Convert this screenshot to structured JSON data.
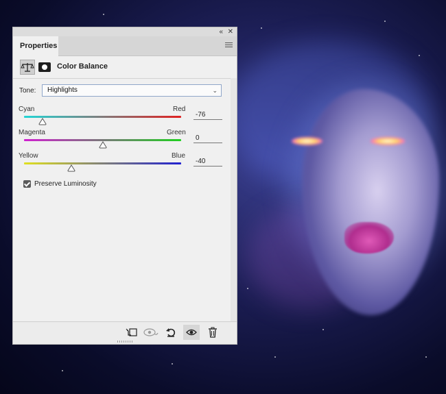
{
  "panel": {
    "tab_label": "Properties",
    "adjustment_title": "Color Balance",
    "tone": {
      "label": "Tone:",
      "value": "Highlights"
    },
    "sliders": [
      {
        "left": "Cyan",
        "right": "Red",
        "value": "-76",
        "level": -76
      },
      {
        "left": "Magenta",
        "right": "Green",
        "value": "0",
        "level": 0
      },
      {
        "left": "Yellow",
        "right": "Blue",
        "value": "-40",
        "level": -40
      }
    ],
    "preserve_luminosity": {
      "label": "Preserve Luminosity",
      "checked": true
    }
  },
  "icons": {
    "collapse": "double-chevron-icon",
    "close": "close-icon",
    "menu": "panel-menu-icon",
    "adjustment": "color-balance-icon",
    "mask": "layer-mask-icon",
    "clip": "clip-to-layer-icon",
    "view_previous": "view-previous-state-icon",
    "reset": "reset-icon",
    "visibility": "visibility-eye-icon",
    "delete": "trash-icon"
  },
  "colors": {
    "cyan_red": [
      "#22d5d5",
      "#e02020"
    ],
    "magenta_green": [
      "#d020d0",
      "#20d020"
    ],
    "yellow_blue": [
      "#e0e020",
      "#2020d0"
    ]
  }
}
